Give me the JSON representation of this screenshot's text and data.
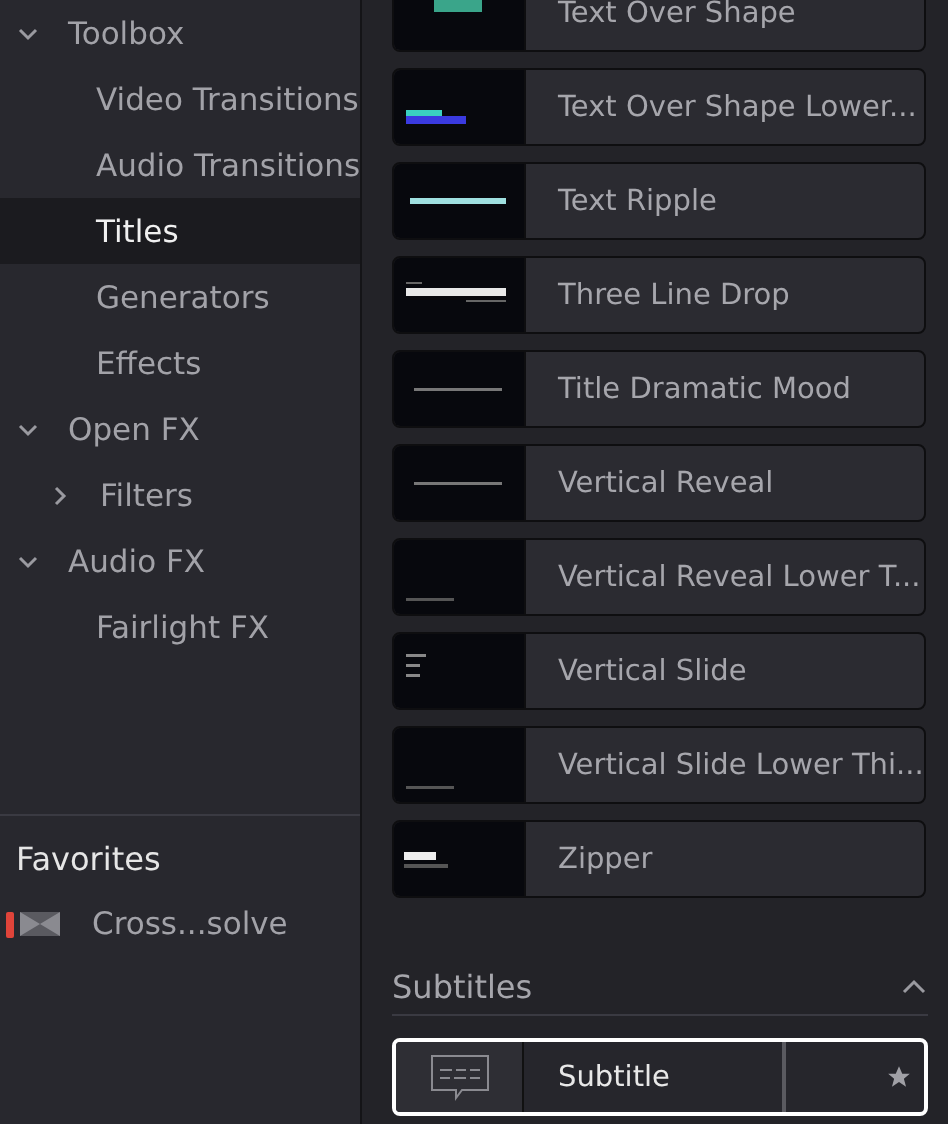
{
  "sidebar": {
    "tree": [
      {
        "label": "Toolbox",
        "expanded": true,
        "selected": false,
        "children": [
          {
            "label": "Video Transitions",
            "selected": false
          },
          {
            "label": "Audio Transitions",
            "selected": false
          },
          {
            "label": "Titles",
            "selected": true
          },
          {
            "label": "Generators",
            "selected": false
          },
          {
            "label": "Effects",
            "selected": false
          }
        ]
      },
      {
        "label": "Open FX",
        "expanded": true,
        "selected": false,
        "children": [
          {
            "label": "Filters",
            "expanded": false,
            "selected": false
          }
        ]
      },
      {
        "label": "Audio FX",
        "expanded": true,
        "selected": false,
        "children": [
          {
            "label": "Fairlight FX",
            "selected": false
          }
        ]
      }
    ],
    "favorites": {
      "title": "Favorites",
      "items": [
        {
          "label": "Cross...solve",
          "color": "#e0443a"
        }
      ]
    }
  },
  "titles": [
    {
      "name": "Text Over Shape",
      "kind": "picture"
    },
    {
      "name": "Text Over Shape Lower...",
      "kind": "picture"
    },
    {
      "name": "Text Ripple",
      "kind": "picture"
    },
    {
      "name": "Three Line Drop",
      "kind": "picture"
    },
    {
      "name": "Title Dramatic Mood",
      "kind": "picture"
    },
    {
      "name": "Vertical Reveal",
      "kind": "picture"
    },
    {
      "name": "Vertical Reveal Lower T...",
      "kind": "picture"
    },
    {
      "name": "Vertical Slide",
      "kind": "picture"
    },
    {
      "name": "Vertical Slide Lower Thi...",
      "kind": "picture"
    },
    {
      "name": "Zipper",
      "kind": "picture"
    }
  ],
  "subtitles": {
    "title": "Subtitles",
    "expanded": true,
    "items": [
      {
        "name": "Subtitle",
        "selected": true,
        "favorite": true
      }
    ]
  }
}
